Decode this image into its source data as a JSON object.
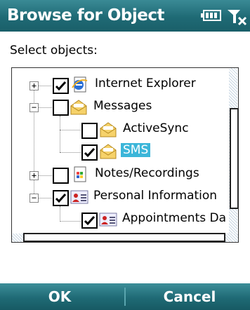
{
  "window": {
    "title": "Browse for Object"
  },
  "status_icons": {
    "battery": "battery-icon",
    "signal": "no-signal-icon"
  },
  "prompt": "Select objects:",
  "tree": {
    "items": [
      {
        "label": "Internet Explorer",
        "checked": true,
        "expander": "+",
        "icon": "internet-explorer-icon"
      },
      {
        "label": "Messages",
        "checked": false,
        "expander": "−",
        "icon": "envelope-icon"
      },
      {
        "label": "ActiveSync",
        "checked": false,
        "expander": "",
        "icon": "envelope-icon"
      },
      {
        "label": "SMS",
        "checked": true,
        "expander": "",
        "icon": "envelope-icon",
        "selected": true
      },
      {
        "label": "Notes/Recordings",
        "checked": false,
        "expander": "+",
        "icon": "notes-icon"
      },
      {
        "label": "Personal Information",
        "checked": true,
        "expander": "−",
        "icon": "contact-card-icon"
      },
      {
        "label": "Appointments Da",
        "checked": true,
        "expander": "",
        "icon": "contact-card-icon"
      }
    ]
  },
  "softkeys": {
    "left": "OK",
    "right": "Cancel"
  },
  "colors": {
    "title_bar": "#1f6a75",
    "selection": "#3cb6d9"
  }
}
